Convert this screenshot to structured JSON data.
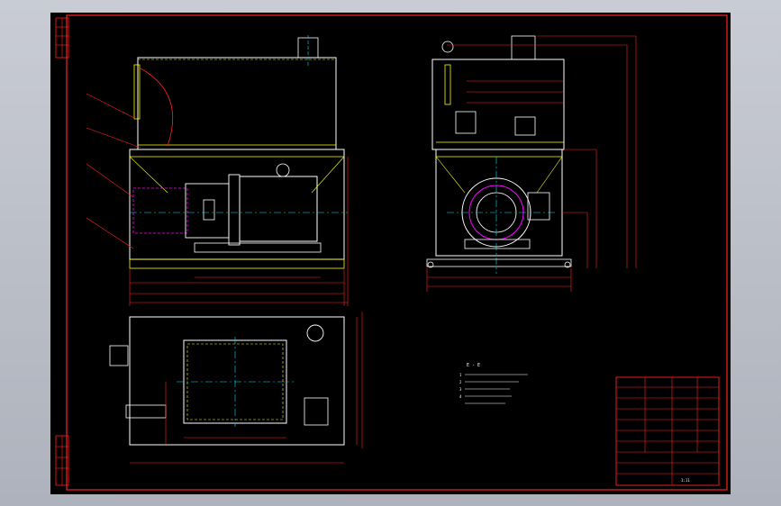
{
  "drawing": {
    "view_label": "E - E",
    "notes": [
      "1",
      "2",
      "3",
      "4"
    ],
    "title_block_text": "1:11"
  },
  "colors": {
    "background": "#000000",
    "border": "#ff0000",
    "outline": "#ffffff",
    "dimension": "#ff3030",
    "centerline": "#00e5ff",
    "hidden": "#ff00ff",
    "accent": "#ffff00"
  }
}
